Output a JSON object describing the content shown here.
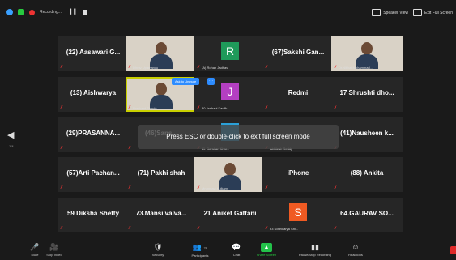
{
  "topbar": {
    "recording_label": "Recording...",
    "pause_glyph": "▌▌",
    "speaker_view_label": "Speaker View",
    "exit_fullscreen_label": "Exit Full Screen"
  },
  "toast": {
    "text": "Press ESC or double-click to exit full screen mode"
  },
  "sidebar": {
    "page_label": "1/4"
  },
  "ask_to_unmute_label": "Ask to Unmute",
  "more_glyph": "···",
  "tiles": [
    {
      "name": "(22) Aasawari G...",
      "caption": ""
    },
    {
      "name": "",
      "caption": "Dhruv Upamanyu",
      "video": true
    },
    {
      "name": "R",
      "caption": "(A) Rohan Jadhav",
      "avatar_color": "#1f9a5a"
    },
    {
      "name": "(67)Sakshi  Gan...",
      "caption": ""
    },
    {
      "name": "",
      "caption": "Dr.Nikhat Mohammad...",
      "video": true
    },
    {
      "name": "(13) Aishwarya",
      "caption": ""
    },
    {
      "name": "",
      "caption": "Prashant Shinde",
      "video": true,
      "active": true
    },
    {
      "name": "J",
      "caption": "30 Janhavi Kadlik...",
      "avatar_color": "#b43fc2"
    },
    {
      "name": "Redmi",
      "caption": ""
    },
    {
      "name": "17 Shrushti dho...",
      "caption": ""
    },
    {
      "name": "(29)PRASANNA...",
      "caption": ""
    },
    {
      "name": "(46)Sans...",
      "caption": ""
    },
    {
      "name": "",
      "caption": "11. Darshan Khar...",
      "avatar_color": "#2aa0d8"
    },
    {
      "name": "",
      "caption": "Abhilesh Reddy"
    },
    {
      "name": "(41)Nausheen  k...",
      "caption": ""
    },
    {
      "name": "(57)Arti  Pachan...",
      "caption": ""
    },
    {
      "name": "(71) Pakhi shah",
      "caption": ""
    },
    {
      "name": "",
      "caption": "Mrunmayi Kulkarni",
      "video": true
    },
    {
      "name": "iPhone",
      "caption": ""
    },
    {
      "name": "(88) Ankita",
      "caption": ""
    },
    {
      "name": "59 Diksha Shetty",
      "caption": ""
    },
    {
      "name": "73.Mansi  valva...",
      "caption": ""
    },
    {
      "name": "21 Aniket Gattani",
      "caption": ""
    },
    {
      "name": "S",
      "caption": "63 Soundarya Shi...",
      "avatar_color": "#f05a22"
    },
    {
      "name": "64.GAURAV  SO...",
      "caption": ""
    }
  ],
  "toolbar": {
    "mute": {
      "label": "Mute",
      "icon": "🎤"
    },
    "video": {
      "label": "Stop Video",
      "icon": "🎥"
    },
    "security": {
      "label": "Security",
      "icon": "🛡"
    },
    "participants": {
      "label": "Participants",
      "icon": "👥",
      "count": "75"
    },
    "chat": {
      "label": "Chat",
      "icon": "💬"
    },
    "share": {
      "label": "Share Screen",
      "icon": "▲"
    },
    "record": {
      "label": "Pause/Stop Recording",
      "icon": "▮▮"
    },
    "reactions": {
      "label": "Reactions",
      "icon": "☺"
    }
  },
  "colors": {
    "share_green": "#23c24a",
    "accent_blue": "#2d8cff",
    "mic_off_red": "#e33333",
    "end_red": "#e02828"
  }
}
